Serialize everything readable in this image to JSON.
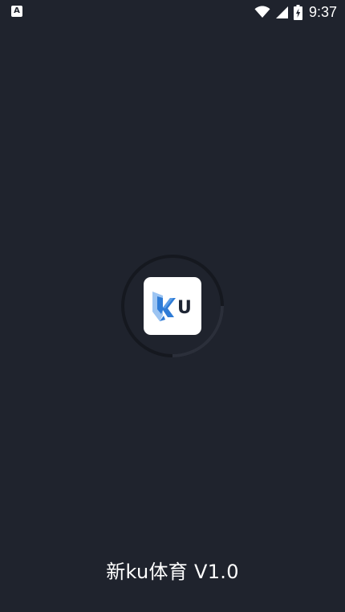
{
  "status_bar": {
    "notification_icon": "a-letter-notification-icon",
    "wifi_icon": "wifi-icon",
    "signal_icon": "cellular-signal-icon",
    "battery_icon": "battery-charging-icon",
    "time": "9:37"
  },
  "splash": {
    "logo_icon": "ku-logo-icon",
    "logo_text": "U",
    "loading_ring": "loading-spinner",
    "app_name": "新ku体育 V1.0"
  },
  "colors": {
    "background": "#1f232d",
    "ring_track": "#15181f",
    "ring_indicator": "#2b2f3a",
    "logo_blue_light": "#8ab8f0",
    "logo_blue_dark": "#2e7bd6",
    "logo_text": "#1e2533"
  }
}
